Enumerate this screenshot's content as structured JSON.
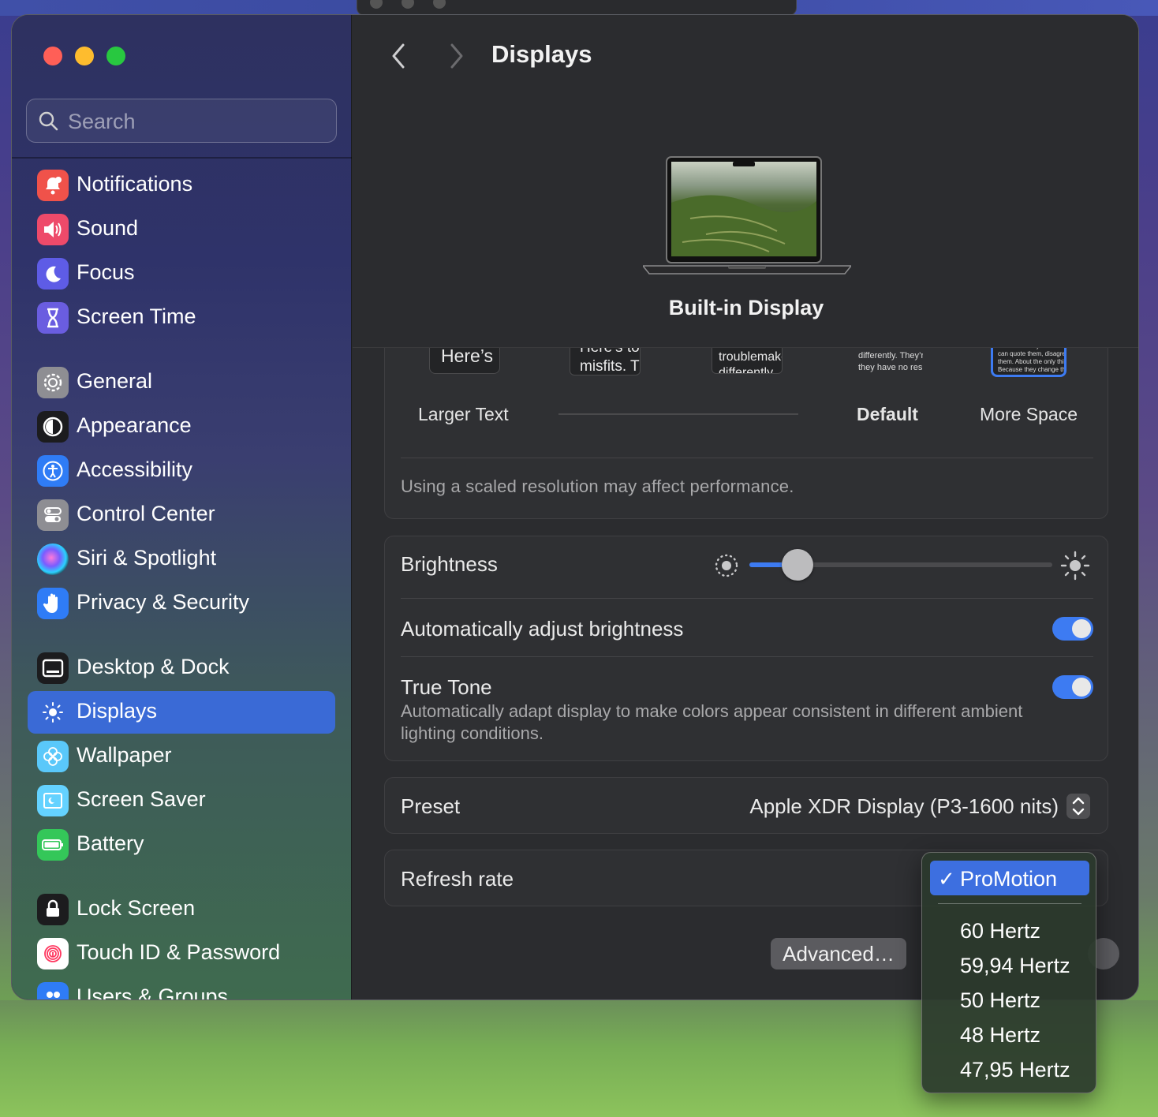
{
  "app": {
    "title": "Displays"
  },
  "search": {
    "placeholder": "Search"
  },
  "sidebar": {
    "items": [
      {
        "label": "Notifications"
      },
      {
        "label": "Sound"
      },
      {
        "label": "Focus"
      },
      {
        "label": "Screen Time"
      },
      {
        "label": "General"
      },
      {
        "label": "Appearance"
      },
      {
        "label": "Accessibility"
      },
      {
        "label": "Control Center"
      },
      {
        "label": "Siri & Spotlight"
      },
      {
        "label": "Privacy & Security"
      },
      {
        "label": "Desktop & Dock"
      },
      {
        "label": "Displays"
      },
      {
        "label": "Wallpaper"
      },
      {
        "label": "Screen Saver"
      },
      {
        "label": "Battery"
      },
      {
        "label": "Lock Screen"
      },
      {
        "label": "Touch ID & Password"
      },
      {
        "label": "Users & Groups"
      }
    ],
    "selected": "Displays"
  },
  "display": {
    "name": "Built-in Display"
  },
  "resolution": {
    "options": [
      {
        "label": "Larger Text",
        "preview": "Here’s"
      },
      {
        "label": "",
        "preview": "Here’s to the crazy ones. The misfits. The troublemakers."
      },
      {
        "label": "",
        "preview": "Here’s to the crazy ones. The troublemakers. The ones who see things differently."
      },
      {
        "label": "Default",
        "preview": "Here’s to the crazy ones. The troublemakers. The ones who see things differently. They’re not fond of rules. And they have no respect for the status quo."
      },
      {
        "label": "More Space",
        "preview": "troublemakers. The round pegs in the square holes. The ones who see things differently. They’re not fond of rules. And they have no respect for the status quo. You can quote them, disagree with them, glorify or vilify them. About the only thing you can’t do is ignore them. Because they change things."
      }
    ],
    "selected": "More Space",
    "note": "Using a scaled resolution may affect performance."
  },
  "brightness": {
    "label": "Brightness",
    "level": 0.16,
    "auto_label": "Automatically adjust brightness",
    "auto_on": true,
    "true_tone_label": "True Tone",
    "true_tone_desc": "Automatically adapt display to make colors appear consistent in different ambient lighting conditions.",
    "true_tone_on": true
  },
  "preset": {
    "label": "Preset",
    "value": "Apple XDR Display (P3-1600 nits)"
  },
  "refresh": {
    "label": "Refresh rate"
  },
  "buttons": {
    "advanced": "Advanced…",
    "help": "?"
  },
  "refresh_menu": {
    "selected": "ProMotion",
    "check": "✓",
    "options": [
      "60 Hertz",
      "59,94 Hertz",
      "50 Hertz",
      "48 Hertz",
      "47,95 Hertz"
    ]
  },
  "colors": {
    "accent": "#3d7bf2",
    "selection": "#3a6ad6"
  }
}
